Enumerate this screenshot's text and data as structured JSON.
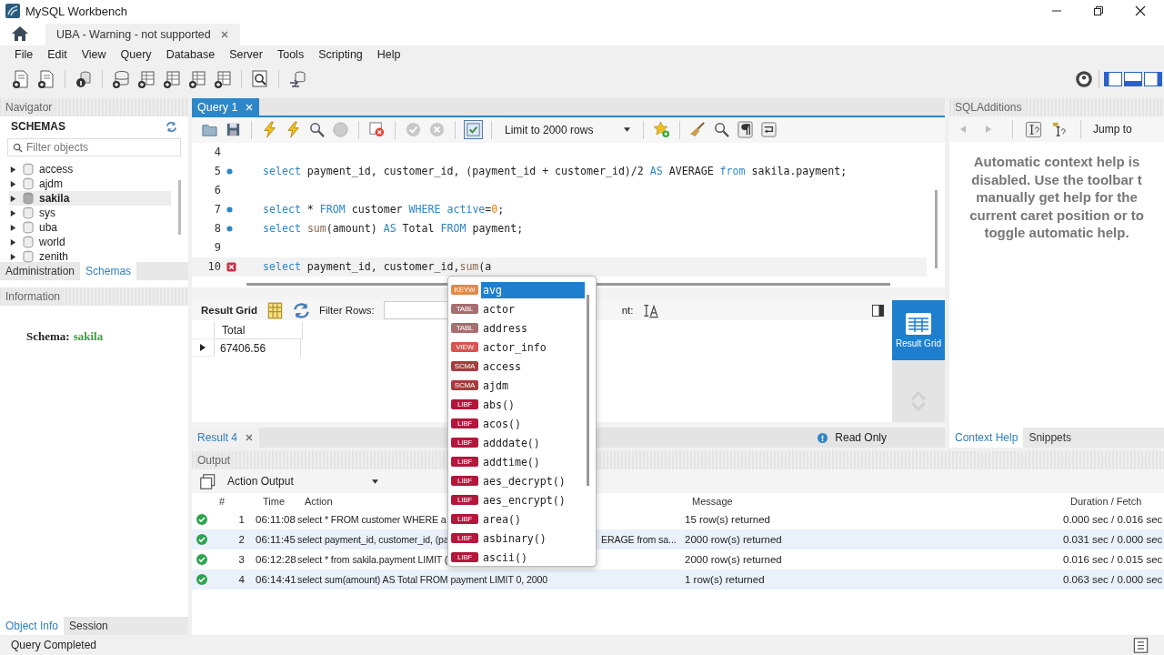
{
  "window": {
    "title": "MySQL Workbench"
  },
  "document_tab": {
    "label": "UBA - Warning - not supported"
  },
  "menu": [
    "File",
    "Edit",
    "View",
    "Query",
    "Database",
    "Server",
    "Tools",
    "Scripting",
    "Help"
  ],
  "navigator": {
    "title": "Navigator",
    "schemas_title": "SCHEMAS",
    "filter": {
      "placeholder": "Filter objects"
    },
    "schemas": [
      {
        "name": "access",
        "selected": false,
        "expanded": false
      },
      {
        "name": "ajdm",
        "selected": false,
        "expanded": false
      },
      {
        "name": "sakila",
        "selected": true,
        "expanded": false
      },
      {
        "name": "sys",
        "selected": false,
        "expanded": false
      },
      {
        "name": "uba",
        "selected": false,
        "expanded": false
      },
      {
        "name": "world",
        "selected": false,
        "expanded": false
      },
      {
        "name": "zenith",
        "selected": false,
        "expanded": false
      }
    ],
    "tabs": [
      {
        "label": "Administration",
        "selected": false
      },
      {
        "label": "Schemas",
        "selected": true
      }
    ]
  },
  "information": {
    "title": "Information",
    "label": "Schema:",
    "value": "sakila"
  },
  "left_bottom_tabs": [
    {
      "label": "Object Info",
      "selected": true
    },
    {
      "label": "Session",
      "selected": false
    }
  ],
  "query_tabs": [
    {
      "label": "Query 1",
      "selected": true
    }
  ],
  "limit_dropdown": {
    "value": "Limit to 2000 rows"
  },
  "editor": {
    "lines": [
      {
        "number": "4",
        "statement": false,
        "error": false,
        "current": false
      },
      {
        "number": "5",
        "statement": true,
        "error": false,
        "current": false,
        "tokens": [
          {
            "kind": "keyword",
            "text": "select"
          },
          {
            "kind": "plain",
            "text": " payment_id, customer_id, (payment_id + customer_id)/2 "
          },
          {
            "kind": "keyword",
            "text": "AS"
          },
          {
            "kind": "plain",
            "text": " AVERAGE "
          },
          {
            "kind": "keyword",
            "text": "from"
          },
          {
            "kind": "plain",
            "text": " sakila.payment;"
          }
        ]
      },
      {
        "number": "6",
        "statement": false,
        "error": false,
        "current": false
      },
      {
        "number": "7",
        "statement": true,
        "error": false,
        "current": false,
        "tokens": [
          {
            "kind": "keyword",
            "text": "select"
          },
          {
            "kind": "plain",
            "text": " * "
          },
          {
            "kind": "keyword",
            "text": "FROM"
          },
          {
            "kind": "plain",
            "text": " customer "
          },
          {
            "kind": "keyword",
            "text": "WHERE active"
          },
          {
            "kind": "plain",
            "text": "="
          },
          {
            "kind": "number",
            "text": "0"
          },
          {
            "kind": "plain",
            "text": ";"
          }
        ]
      },
      {
        "number": "8",
        "statement": true,
        "error": false,
        "current": false,
        "tokens": [
          {
            "kind": "keyword",
            "text": "select "
          },
          {
            "kind": "function",
            "text": "sum"
          },
          {
            "kind": "plain",
            "text": "(amount) "
          },
          {
            "kind": "keyword",
            "text": "AS"
          },
          {
            "kind": "plain",
            "text": " Total "
          },
          {
            "kind": "keyword",
            "text": "FROM"
          },
          {
            "kind": "plain",
            "text": " payment;"
          }
        ]
      },
      {
        "number": "9",
        "statement": false,
        "error": false,
        "current": false
      },
      {
        "number": "10",
        "statement": false,
        "error": true,
        "current": true,
        "tokens": [
          {
            "kind": "keyword",
            "text": "select"
          },
          {
            "kind": "plain",
            "text": " payment_id, customer_id,"
          },
          {
            "kind": "function",
            "text": "sum"
          },
          {
            "kind": "plain",
            "text": "(a"
          }
        ]
      }
    ]
  },
  "autocomplete": [
    {
      "badge": "KEYW",
      "name": "avg",
      "color": "#e0894a",
      "selected": true
    },
    {
      "badge": "TABL",
      "name": "actor",
      "color": "#a66e6e",
      "selected": false
    },
    {
      "badge": "TABL",
      "name": "address",
      "color": "#a66e6e",
      "selected": false
    },
    {
      "badge": "VIEW",
      "name": "actor_info",
      "color": "#d9534f",
      "selected": false
    },
    {
      "badge": "SCMA",
      "name": "access",
      "color": "#a63c3c",
      "selected": false
    },
    {
      "badge": "SCMA",
      "name": "ajdm",
      "color": "#a63c3c",
      "selected": false
    },
    {
      "badge": "LIBF",
      "name": "abs()",
      "color": "#b3173c",
      "selected": false
    },
    {
      "badge": "LIBF",
      "name": "acos()",
      "color": "#b3173c",
      "selected": false
    },
    {
      "badge": "LIBF",
      "name": "adddate()",
      "color": "#b3173c",
      "selected": false
    },
    {
      "badge": "LIBF",
      "name": "addtime()",
      "color": "#b3173c",
      "selected": false
    },
    {
      "badge": "LIBF",
      "name": "aes_decrypt()",
      "color": "#b3173c",
      "selected": false
    },
    {
      "badge": "LIBF",
      "name": "aes_encrypt()",
      "color": "#b3173c",
      "selected": false
    },
    {
      "badge": "LIBF",
      "name": "area()",
      "color": "#b3173c",
      "selected": false
    },
    {
      "badge": "LIBF",
      "name": "asbinary()",
      "color": "#b3173c",
      "selected": false
    },
    {
      "badge": "LIBF",
      "name": "ascii()",
      "color": "#b3173c",
      "selected": false
    }
  ],
  "result": {
    "grid_label": "Result Grid",
    "filter_label": "Filter Rows:",
    "format_label_tail": "nt:",
    "columns": [
      "Total"
    ],
    "rows": [
      [
        "67406.56"
      ]
    ],
    "side_button": {
      "label": "Result Grid",
      "selected": true
    },
    "tabs": [
      {
        "label": "Result 4",
        "selected": true
      }
    ],
    "read_only": "Read Only"
  },
  "sql_additions": {
    "title": "SQLAdditions",
    "jump_to": "Jump to",
    "help_lines": [
      "Automatic context help is",
      "disabled. Use the toolbar t",
      "manually get help for the",
      "current caret position or to",
      "toggle automatic help."
    ],
    "tabs": [
      {
        "label": "Context Help",
        "selected": true
      },
      {
        "label": "Snippets",
        "selected": false
      }
    ]
  },
  "output": {
    "title": "Output",
    "dropdown": "Action Output",
    "columns": [
      "#",
      "Time",
      "Action",
      "Message",
      "Duration / Fetch"
    ],
    "rows": [
      {
        "success": true,
        "number": "1",
        "time": "06:11:08",
        "action": "select * FROM customer WHERE a",
        "message": "15 row(s) returned",
        "duration": "0.000 sec / 0.016 sec"
      },
      {
        "success": true,
        "number": "2",
        "time": "06:11:45",
        "action": "select payment_id, customer_id, (pa",
        "action_tail": "ERAGE from sa...",
        "message": "2000 row(s) returned",
        "duration": "0.031 sec / 0.000 sec"
      },
      {
        "success": true,
        "number": "3",
        "time": "06:12:28",
        "action": "select * from sakila.payment LIMIT (",
        "message": "2000 row(s) returned",
        "duration": "0.016 sec / 0.015 sec"
      },
      {
        "success": true,
        "number": "4",
        "time": "06:14:41",
        "action": "select sum(amount) AS Total FROM payment LIMIT 0, 2000",
        "message": "1 row(s) returned",
        "duration": "0.063 sec / 0.000 sec"
      }
    ]
  },
  "status_bar": {
    "text": "Query Completed"
  }
}
